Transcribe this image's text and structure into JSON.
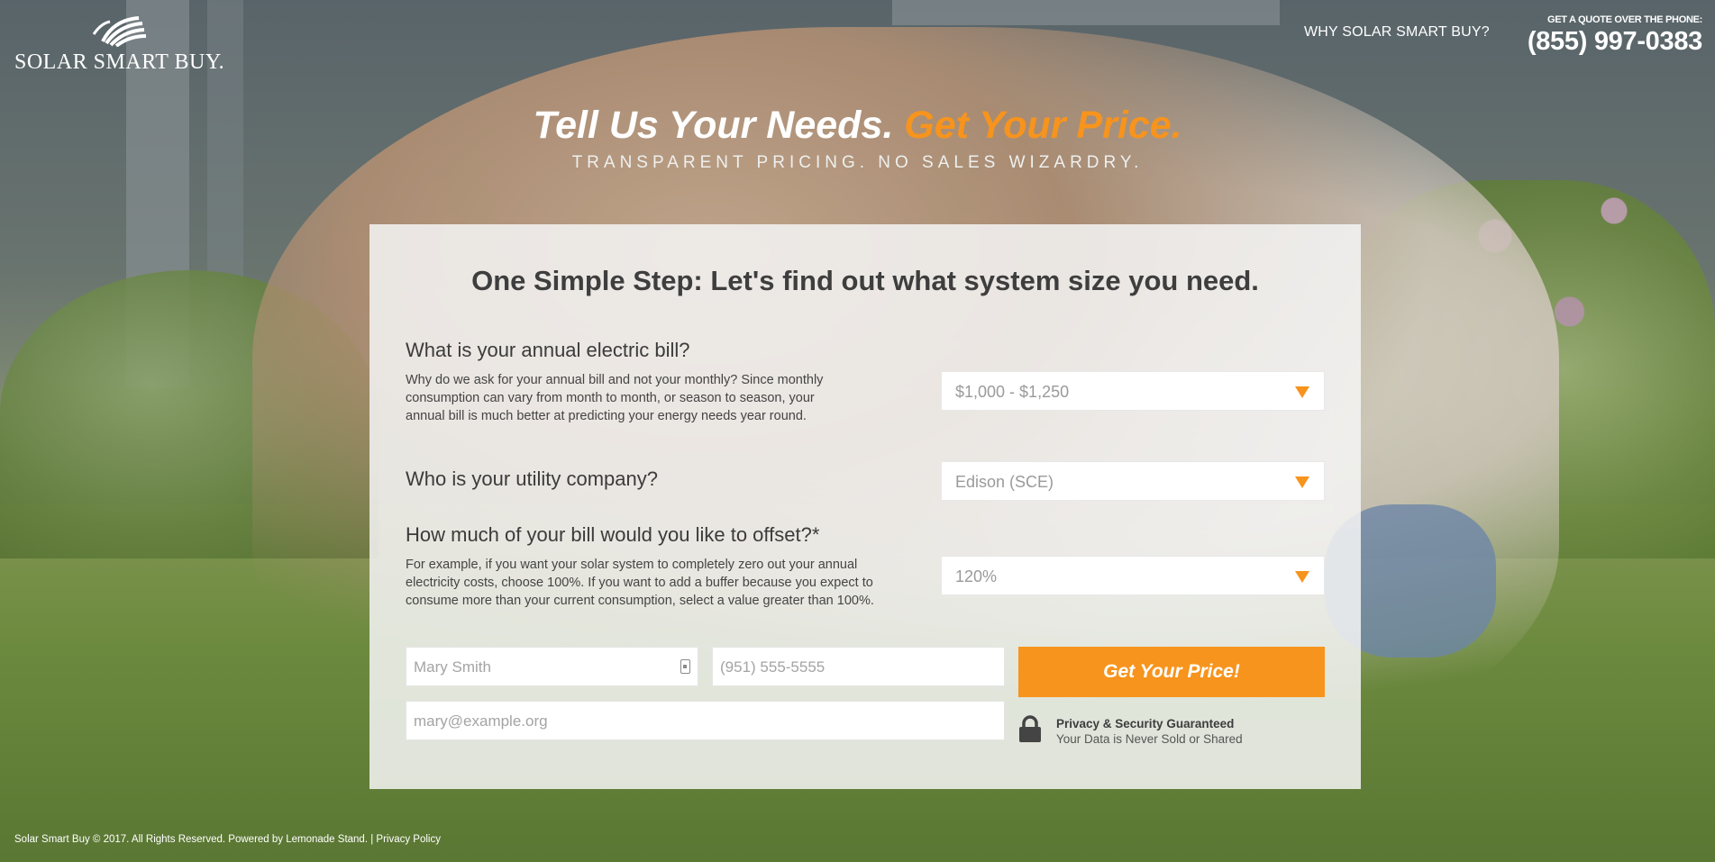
{
  "brand": {
    "name": "SOLAR SMART BUY."
  },
  "nav": {
    "why_link": "WHY SOLAR SMART BUY?",
    "quote_label": "GET A QUOTE OVER THE PHONE:",
    "phone": "(855) 997-0383"
  },
  "hero": {
    "title_main": "Tell Us Your Needs.",
    "title_accent": "Get Your Price.",
    "subtitle": "TRANSPARENT PRICING. NO SALES WIZARDRY."
  },
  "form": {
    "title": "One Simple Step: Let's find out what system size you need.",
    "questions": [
      {
        "heading": "What is your annual electric bill?",
        "description": "Why do we ask for your annual bill and not your monthly? Since monthly consumption can vary from month to month, or season to season, your annual bill is much better at predicting your energy needs year round.",
        "selected": "$1,000 - $1,250"
      },
      {
        "heading": "Who is your utility company?",
        "description": "",
        "selected": "Edison (SCE)"
      },
      {
        "heading": "How much of your bill would you like to offset?*",
        "description": "For example, if you want your solar system to completely zero out your annual electricity costs, choose 100%. If you want to add a buffer because you expect to consume more than your current consumption, select a value greater than 100%.",
        "selected": "120%"
      }
    ],
    "name_placeholder": "Mary Smith",
    "phone_placeholder": "(951) 555-5555",
    "email_placeholder": "mary@example.org",
    "submit_label": "Get Your Price!",
    "privacy_title": "Privacy & Security Guaranteed",
    "privacy_text": "Your Data is Never Sold or Shared"
  },
  "footer": {
    "copyright": "Solar Smart Buy © 2017. All Rights Reserved. Powered by Lemonade Stand. |",
    "privacy_link": "Privacy Policy"
  },
  "colors": {
    "accent": "#f7941d",
    "card_bg": "#f5f5f5",
    "text_dark": "#3e3e3e"
  }
}
